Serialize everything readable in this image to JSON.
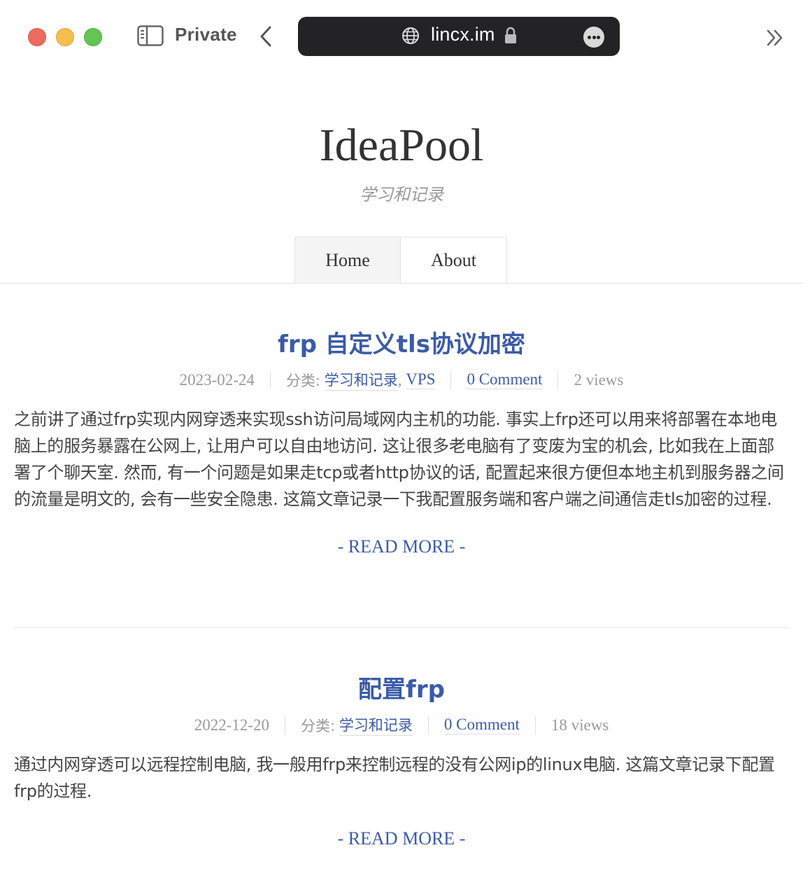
{
  "browser": {
    "private_label": "Private",
    "url": "lincx.im"
  },
  "site": {
    "title": "IdeaPool",
    "subtitle": "学习和记录"
  },
  "nav": {
    "items": [
      {
        "label": "Home"
      },
      {
        "label": "About"
      }
    ]
  },
  "posts": [
    {
      "title": "frp 自定义tls协议加密",
      "date": "2023-02-24",
      "category_label": "分类:",
      "categories": [
        "学习和记录",
        "VPS"
      ],
      "category_separator": ",",
      "comments": "0 Comment",
      "views": "2 views",
      "excerpt": "之前讲了通过frp实现内网穿透来实现ssh访问局域网内主机的功能. 事实上frp还可以用来将部署在本地电脑上的服务暴露在公网上, 让用户可以自由地访问. 这让很多老电脑有了变废为宝的机会, 比如我在上面部署了个聊天室. 然而, 有一个问题是如果走tcp或者http协议的话, 配置起来很方便但本地主机到服务器之间的流量是明文的, 会有一些安全隐患. 这篇文章记录一下我配置服务端和客户端之间通信走tls加密的过程.",
      "read_more": "- READ MORE -"
    },
    {
      "title": "配置frp",
      "date": "2022-12-20",
      "category_label": "分类:",
      "categories": [
        "学习和记录"
      ],
      "comments": "0 Comment",
      "views": "18 views",
      "excerpt": "通过内网穿透可以远程控制电脑, 我一般用frp来控制远程的没有公网ip的linux电脑. 这篇文章记录下配置frp的过程.",
      "read_more": "- READ MORE -"
    }
  ]
}
